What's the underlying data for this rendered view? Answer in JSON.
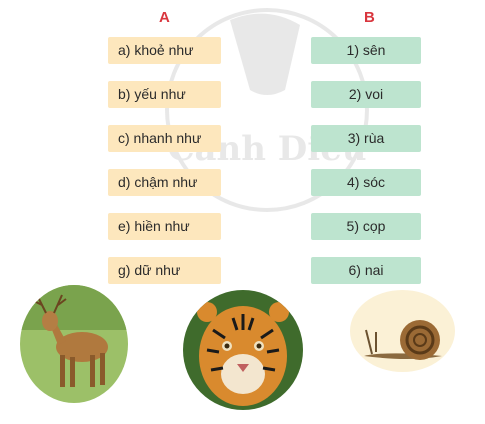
{
  "column_a": {
    "heading": "A",
    "items": [
      "a) khoẻ như",
      "b) yếu như",
      "c) nhanh như",
      "d) chậm như",
      "e) hiền như",
      "g) dữ như"
    ]
  },
  "column_b": {
    "heading": "B",
    "items": [
      "1) sên",
      "2) voi",
      "3) rùa",
      "4) sóc",
      "5) cọp",
      "6) nai"
    ]
  },
  "watermark_text": "Cánh Diều",
  "photos": [
    "deer",
    "tiger",
    "snail"
  ],
  "colors": {
    "heading": "#d9363e",
    "card_a": "#fde7bd",
    "card_b": "#bde4cf"
  }
}
